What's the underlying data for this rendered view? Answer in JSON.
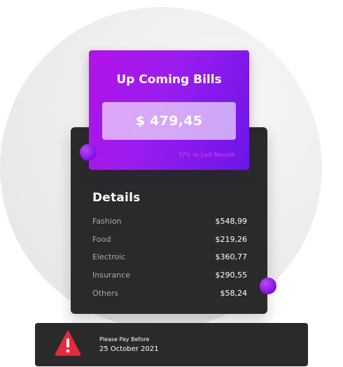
{
  "bills": {
    "title": "Up Coming Bills",
    "amount": "$ 479,45",
    "comparison": "37%  vs Last Mounth"
  },
  "details": {
    "title": "Details",
    "items": [
      {
        "label": "Fashion",
        "value": "$548,99"
      },
      {
        "label": "Food",
        "value": "$219,26"
      },
      {
        "label": "Electroic",
        "value": "$360,77"
      },
      {
        "label": "Insurance",
        "value": "$290,55"
      },
      {
        "label": "Others",
        "value": "$58,24"
      }
    ]
  },
  "alert": {
    "line1": "Please Pay Before",
    "line2": "25 October 2021",
    "icon": "warning-icon"
  },
  "colors": {
    "accent_purple": "#9a1cee",
    "card_dark": "#2a2a2a",
    "alert_red": "#e8283c"
  }
}
